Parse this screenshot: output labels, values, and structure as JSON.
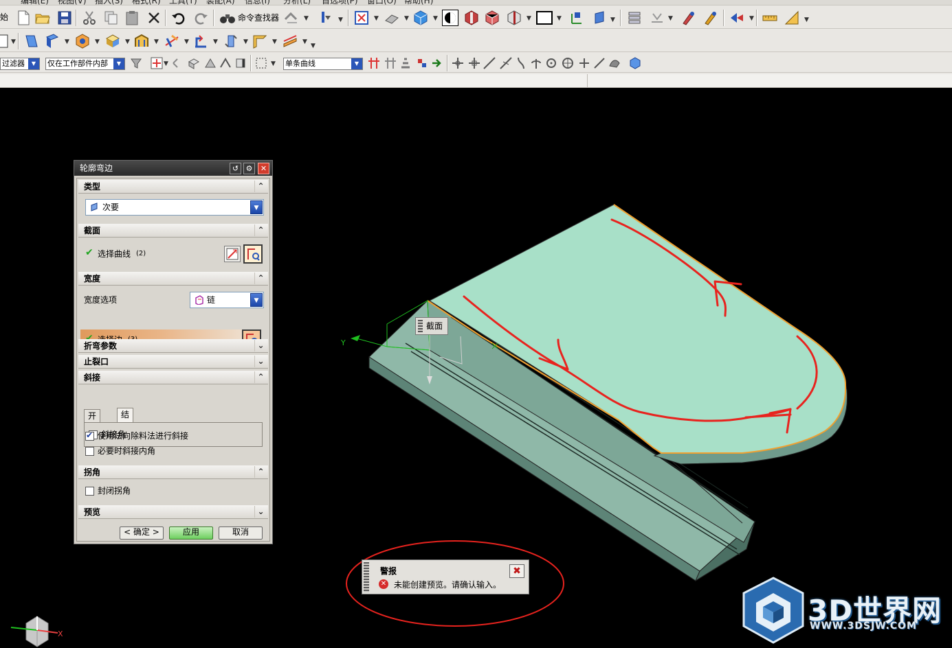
{
  "menubar": {
    "items": [
      "编辑(E)",
      "视图(V)",
      "插入(S)",
      "格式(R)",
      "工具(T)",
      "装配(A)",
      "信息(I)",
      "分析(L)",
      "首选项(P)",
      "窗口(O)",
      "帮助(H)"
    ]
  },
  "toolbar": {
    "row1_left_fragment": "始",
    "command_finder_label": "命令查找器",
    "filter_combo": "过滤器",
    "scope_combo": "仅在工作部件内部",
    "curve_rule_combo": "单条曲线"
  },
  "dialog": {
    "title": "轮廓弯边",
    "sections": {
      "type": {
        "header": "类型",
        "value": "次要"
      },
      "section": {
        "header": "截面",
        "select_curve_label": "选择曲线",
        "select_curve_count": "(2)"
      },
      "width": {
        "header": "宽度",
        "width_option_label": "宽度选项",
        "width_option_value": "链",
        "select_edge_label": "选择边",
        "select_edge_count": "(3)"
      },
      "bend_params": {
        "header": "折弯参数"
      },
      "relief": {
        "header": "止裂口"
      },
      "miter": {
        "header": "斜接",
        "tab_start": "开始端",
        "tab_end": "结束端",
        "miter_angle_label": "斜接角",
        "miter_angle_checked": false,
        "use_normal_cut_label": "使用法向除料法进行斜接",
        "use_normal_cut_checked": true,
        "miter_inner_corner_label": "必要时斜接内角",
        "miter_inner_corner_checked": false
      },
      "corner": {
        "header": "拐角",
        "close_corner_label": "封闭拐角",
        "close_corner_checked": false
      },
      "preview": {
        "header": "预览"
      }
    },
    "buttons": {
      "ok": "< 确定 >",
      "apply": "应用",
      "cancel": "取消"
    }
  },
  "viewport": {
    "section_label": "截面",
    "wcs_y_label": "Y",
    "triad_x_label": "X"
  },
  "alarm": {
    "title": "警报",
    "message": "未能创建预览。请确认输入。"
  },
  "watermark": {
    "brand": "3D世界网",
    "url": "WWW.3DSJW.COM"
  },
  "colors": {
    "part_face": "#a8dec6",
    "part_side": "#6f9b8c",
    "highlight_edge": "#f0a030",
    "annotation_red": "#e8231e",
    "ok_green": "#1fa51f"
  }
}
